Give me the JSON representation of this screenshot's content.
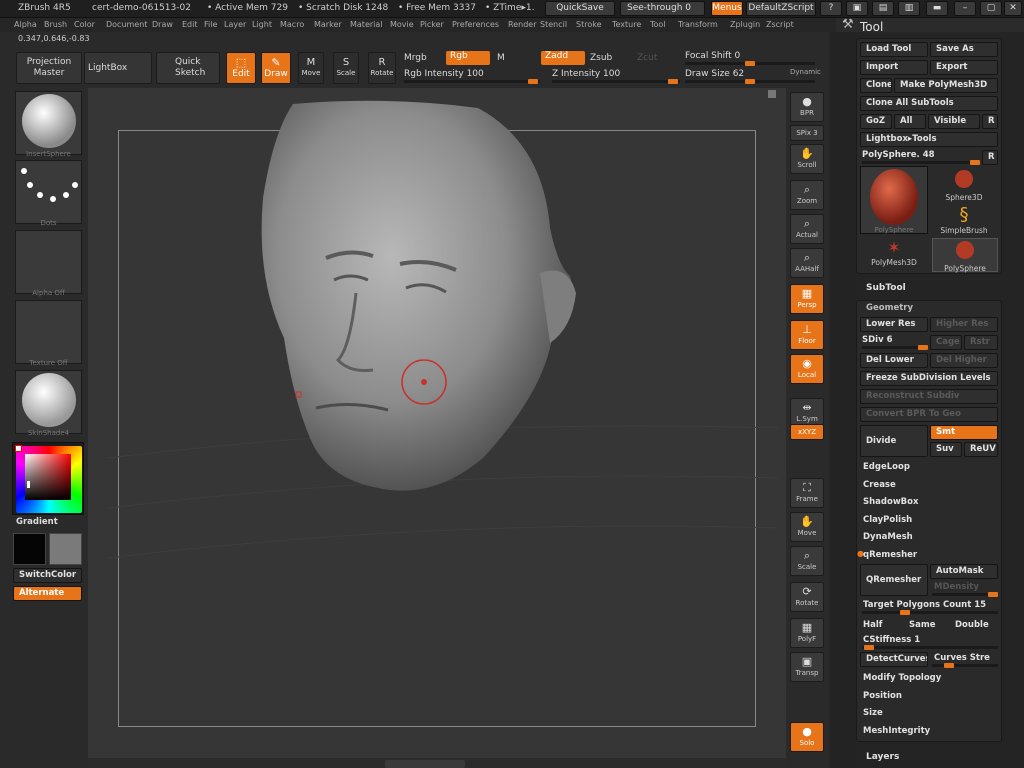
{
  "title_bar": {
    "app": "ZBrush 4R5",
    "doc": "cert-demo-061513-02",
    "active_mem": "• Active Mem 729",
    "scratch": "• Scratch Disk 1248",
    "free_mem": "• Free Mem 3337",
    "ztime": "• ZTime▸1.",
    "quicksave": "QuickSave",
    "see_through": "See-through",
    "see_through_val": "0",
    "menus": "Menus",
    "default_script": "DefaultZScript"
  },
  "menu": [
    "Alpha",
    "Brush",
    "Color",
    "Document",
    "Draw",
    "Edit",
    "File",
    "Layer",
    "Light",
    "Macro",
    "Marker",
    "Material",
    "Movie",
    "Picker",
    "Preferences",
    "Render",
    "Stencil",
    "Stroke",
    "Texture",
    "Tool",
    "Transform",
    "Zplugin",
    "Zscript"
  ],
  "coords": "0.347,0.646,-0.83",
  "toolbar": {
    "projection": "Projection",
    "master": "Master",
    "lightbox": "LightBox",
    "quick": "Quick",
    "sketch": "Sketch",
    "edit": "Edit",
    "draw": "Draw",
    "move": "Move",
    "scale": "Scale",
    "rotate": "Rotate",
    "mrgb": "Mrgb",
    "rgb": "Rgb",
    "m": "M",
    "zadd": "Zadd",
    "zsub": "Zsub",
    "zcut": "Zcut",
    "rgb_intensity": "Rgb Intensity 100",
    "z_intensity": "Z Intensity 100",
    "focal_shift": "Focal Shift 0",
    "draw_size": "Draw Size 62",
    "dynamic": "Dynamic",
    "focal_val": 0.5,
    "draw_size_val": 0.5
  },
  "left": {
    "thumbs": [
      "InsertSphere",
      "Dots",
      "Alpha Off",
      "Texture Off",
      "SkinShade4"
    ],
    "gradient": "Gradient",
    "switch_color": "SwitchColor",
    "alternate": "Alternate"
  },
  "right_strip": [
    {
      "label": "BPR",
      "icon": "bpr-icon"
    },
    {
      "label": "SPix 3",
      "icon": ""
    },
    {
      "label": "Scroll",
      "icon": "scroll-icon"
    },
    {
      "label": "Zoom",
      "icon": "zoom-icon"
    },
    {
      "label": "Actual",
      "icon": "actual-icon"
    },
    {
      "label": "AAHalf",
      "icon": "aahalf-icon"
    },
    {
      "label": "Persp",
      "icon": "persp-icon"
    },
    {
      "label": "Floor",
      "icon": "floor-icon"
    },
    {
      "label": "Local",
      "icon": "local-icon"
    },
    {
      "label": "L.Sym",
      "icon": "lsym-icon"
    },
    {
      "label": "xXYZ",
      "icon": ""
    },
    {
      "label": "Frame",
      "icon": "frame-icon"
    },
    {
      "label": "Move",
      "icon": "move-icon"
    },
    {
      "label": "Scale",
      "icon": "scale-icon"
    },
    {
      "label": "Rotate",
      "icon": "rotate-icon"
    },
    {
      "label": "PolyF",
      "icon": "polyf-icon"
    },
    {
      "label": "Transp",
      "icon": "transp-icon"
    },
    {
      "label": "Solo",
      "icon": "solo-icon"
    }
  ],
  "tool": {
    "title": "Tool",
    "load": "Load Tool",
    "save": "Save As",
    "import": "Import",
    "export": "Export",
    "clone": "Clone",
    "make_poly": "Make PolyMesh3D",
    "clone_all": "Clone All SubTools",
    "goz": "GoZ",
    "all": "All",
    "visible": "Visible",
    "r": "R",
    "lightbox_tools": "Lightbox▸Tools",
    "polysphere": "PolySphere. 48",
    "tools": [
      "PolySphere",
      "Sphere3D",
      "SimpleBrush",
      "PolyMesh3D",
      "PolySphere"
    ]
  },
  "subtool": "SubTool",
  "geometry": {
    "title": "Geometry",
    "lower_res": "Lower Res",
    "higher_res": "Higher Res",
    "sdiv": "SDiv 6",
    "cage": "Cage",
    "rstr": "Rstr",
    "del_lower": "Del Lower",
    "del_higher": "Del Higher",
    "freeze": "Freeze SubDivision Levels",
    "reconstruct": "Reconstruct Subdiv",
    "convert_bpr": "Convert BPR To Geo",
    "divide": "Divide",
    "smt": "Smt",
    "suv": "Suv",
    "reuv": "ReUV",
    "edgeloop": "EdgeLoop",
    "crease": "Crease",
    "shadowbox": "ShadowBox",
    "claypolish": "ClayPolish",
    "dynamesh": "DynaMesh",
    "qremesher_h": "qRemesher",
    "qremesher": "QRemesher",
    "automask": "AutoMask",
    "mdensity": "MDensity",
    "target": "Target Polygons Count 15",
    "half": "Half",
    "same": "Same",
    "double": "Double",
    "cstiffness": "CStiffness 1",
    "detect": "DetectCurves",
    "curves_strength": "Curves Stre",
    "modify": "Modify Topology",
    "position": "Position",
    "size": "Size",
    "meshint": "MeshIntegrity"
  },
  "layers": "Layers",
  "colors": {
    "accent": "#e8741a"
  }
}
